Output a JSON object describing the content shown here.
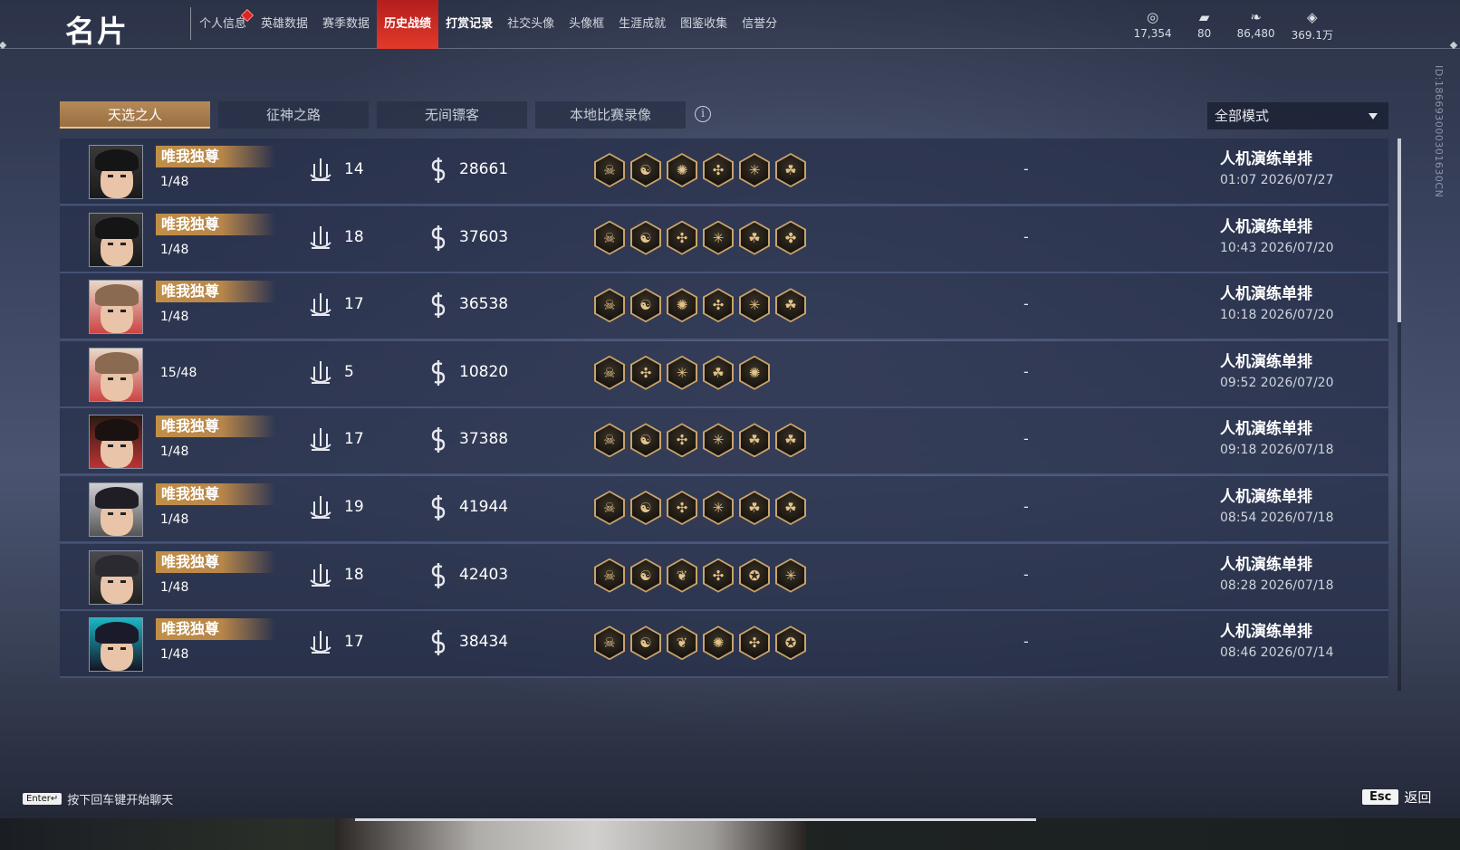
{
  "header": {
    "title": "名片",
    "nav": [
      {
        "label": "个人信息",
        "active": false,
        "bold": false,
        "dot": true
      },
      {
        "label": "英雄数据",
        "active": false,
        "bold": false,
        "dot": false
      },
      {
        "label": "赛季数据",
        "active": false,
        "bold": false,
        "dot": false
      },
      {
        "label": "历史战绩",
        "active": true,
        "bold": true,
        "dot": false
      },
      {
        "label": "打赏记录",
        "active": false,
        "bold": true,
        "dot": false
      },
      {
        "label": "社交头像",
        "active": false,
        "bold": false,
        "dot": false
      },
      {
        "label": "头像框",
        "active": false,
        "bold": false,
        "dot": false
      },
      {
        "label": "生涯成就",
        "active": false,
        "bold": false,
        "dot": false
      },
      {
        "label": "图鉴收集",
        "active": false,
        "bold": false,
        "dot": false
      },
      {
        "label": "信誉分",
        "active": false,
        "bold": false,
        "dot": false
      }
    ],
    "currencies": [
      {
        "icon": "coin-stack-icon",
        "glyph": "◎",
        "value": "17,354"
      },
      {
        "icon": "ticket-icon",
        "glyph": "▰",
        "value": "80"
      },
      {
        "icon": "feather-icon",
        "glyph": "❧",
        "value": "86,480"
      },
      {
        "icon": "diamond-icon",
        "glyph": "◈",
        "value": "369.1万"
      }
    ]
  },
  "tabs": [
    {
      "label": "天选之人",
      "active": true
    },
    {
      "label": "征神之路",
      "active": false
    },
    {
      "label": "无间镖客",
      "active": false
    },
    {
      "label": "本地比赛录像",
      "active": false
    }
  ],
  "mode_filter": {
    "selected": "全部模式"
  },
  "side_id": "ID:186693000301630CN",
  "matches": [
    {
      "badge": "唯我独尊",
      "rank": "1/48",
      "kills": "14",
      "score": "28661",
      "hero": "hero-a",
      "talents": [
        "☠",
        "☯",
        "✺",
        "✣",
        "✳",
        "☘"
      ],
      "result": "-",
      "mode": "人机演练单排",
      "time": "01:07  2026/07/27"
    },
    {
      "badge": "唯我独尊",
      "rank": "1/48",
      "kills": "18",
      "score": "37603",
      "hero": "hero-a",
      "talents": [
        "☠",
        "☯",
        "✣",
        "✳",
        "☘",
        "✤"
      ],
      "result": "-",
      "mode": "人机演练单排",
      "time": "10:43  2026/07/20"
    },
    {
      "badge": "唯我独尊",
      "rank": "1/48",
      "kills": "17",
      "score": "36538",
      "hero": "hero-b",
      "talents": [
        "☠",
        "☯",
        "✺",
        "✣",
        "✳",
        "☘"
      ],
      "result": "-",
      "mode": "人机演练单排",
      "time": "10:18  2026/07/20"
    },
    {
      "badge": "",
      "rank": "15/48",
      "kills": "5",
      "score": "10820",
      "hero": "hero-b",
      "talents": [
        "☠",
        "✣",
        "✳",
        "☘",
        "✺"
      ],
      "result": "-",
      "mode": "人机演练单排",
      "time": "09:52  2026/07/20"
    },
    {
      "badge": "唯我独尊",
      "rank": "1/48",
      "kills": "17",
      "score": "37388",
      "hero": "hero-c",
      "talents": [
        "☠",
        "☯",
        "✣",
        "✳",
        "☘",
        "☘"
      ],
      "result": "-",
      "mode": "人机演练单排",
      "time": "09:18  2026/07/18"
    },
    {
      "badge": "唯我独尊",
      "rank": "1/48",
      "kills": "19",
      "score": "41944",
      "hero": "hero-d",
      "talents": [
        "☠",
        "☯",
        "✣",
        "✳",
        "☘",
        "☘"
      ],
      "result": "-",
      "mode": "人机演练单排",
      "time": "08:54  2026/07/18"
    },
    {
      "badge": "唯我独尊",
      "rank": "1/48",
      "kills": "18",
      "score": "42403",
      "hero": "hero-e",
      "talents": [
        "☠",
        "☯",
        "❦",
        "✣",
        "✪",
        "✳"
      ],
      "result": "-",
      "mode": "人机演练单排",
      "time": "08:28  2026/07/18"
    },
    {
      "badge": "唯我独尊",
      "rank": "1/48",
      "kills": "17",
      "score": "38434",
      "hero": "hero-f",
      "talents": [
        "☠",
        "☯",
        "❦",
        "✺",
        "✣",
        "✪"
      ],
      "result": "-",
      "mode": "人机演练单排",
      "time": "08:46  2026/07/14"
    }
  ],
  "footer": {
    "enter_key": "Enter↵",
    "enter_text": "按下回车键开始聊天",
    "esc_key": "Esc",
    "esc_text": "返回"
  }
}
